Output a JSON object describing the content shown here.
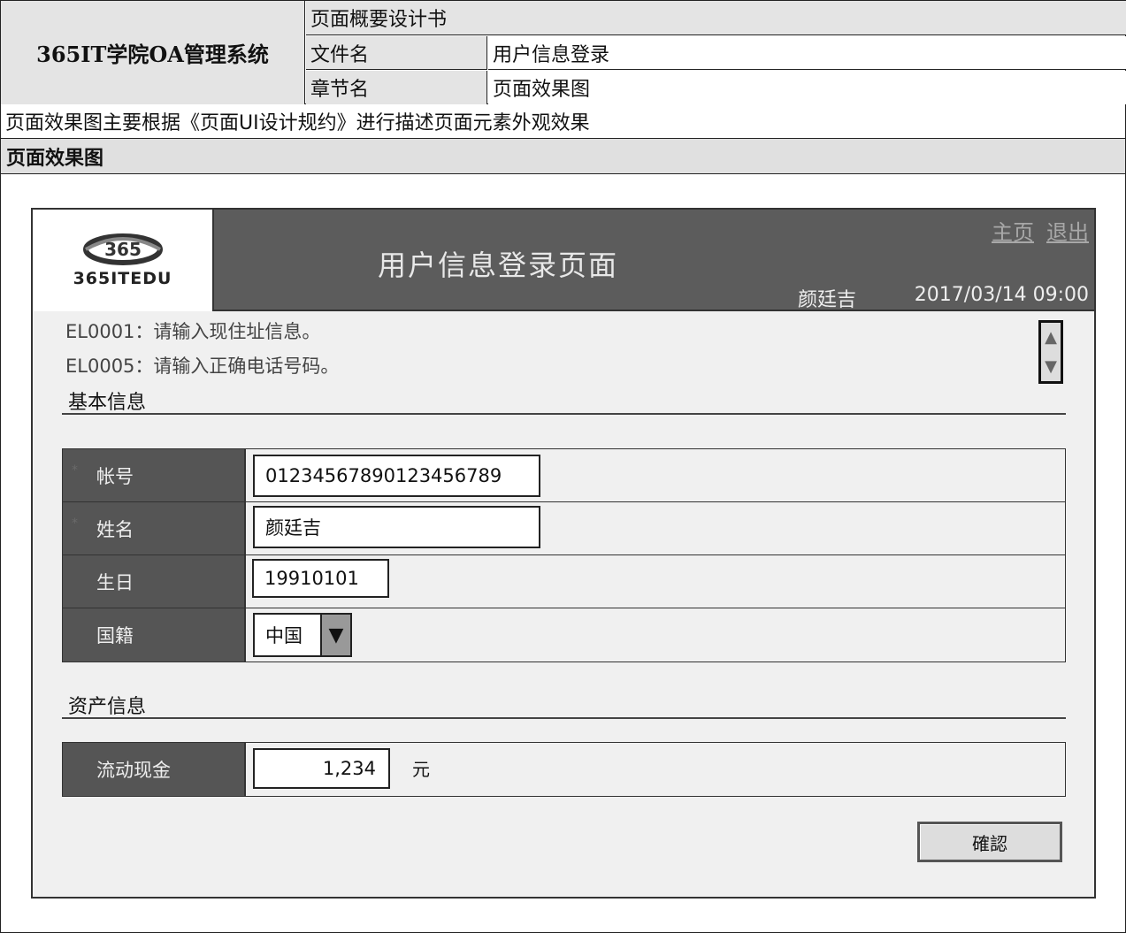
{
  "doc": {
    "system_title": "365IT学院OA管理系统",
    "spec_title": "页面概要设计书",
    "filename_label": "文件名",
    "filename_value": "用户信息登录",
    "chapter_label": "章节名",
    "chapter_value": "页面效果图",
    "description": "页面效果图主要根据《页面UI设计规约》进行描述页面元素外观效果",
    "section_title": "页面效果图"
  },
  "app": {
    "logo_mark": "365",
    "logo_text": "365ITEDU",
    "title": "用户信息登录页面",
    "links": {
      "home": "主页",
      "logout": "退出"
    },
    "user_name": "颜廷吉",
    "datetime": "2017/03/14 09:00",
    "errors": [
      "EL0001：请输入现住址信息。",
      "EL0005：请输入正确电话号码。"
    ],
    "basic_section": {
      "title": "基本信息",
      "fields": {
        "account": {
          "label": "帐号",
          "value": "01234567890123456789"
        },
        "name": {
          "label": "姓名",
          "value": "颜廷吉"
        },
        "birthday": {
          "label": "生日",
          "value": "19910101"
        },
        "nationality": {
          "label": "国籍",
          "value": "中国"
        }
      },
      "required_mark": "*"
    },
    "asset_section": {
      "title": "资产信息",
      "cash": {
        "label": "流动现金",
        "value": "1,234",
        "unit": "元"
      }
    },
    "confirm_label": "確認",
    "icons": {
      "scroll_up": "triangle-up-icon",
      "scroll_down": "triangle-down-icon",
      "dropdown": "triangle-down-icon"
    }
  }
}
